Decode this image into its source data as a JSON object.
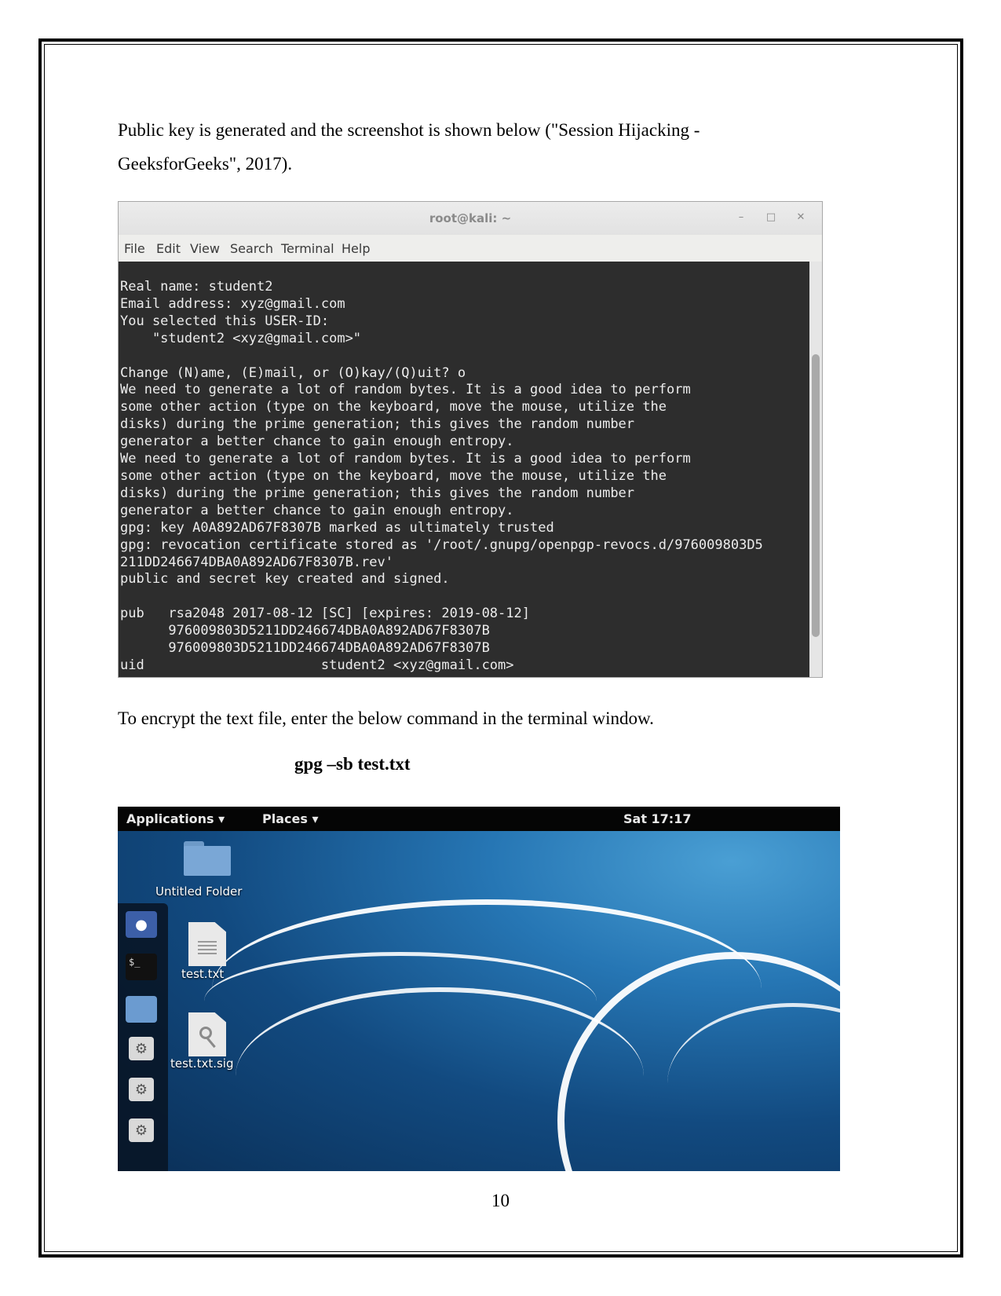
{
  "document": {
    "para1": "Public key is generated and the screenshot is shown below (\"Session Hijacking - GeeksforGeeks\", 2017).",
    "para2": "To encrypt the text file, enter the below command in the terminal window.",
    "command": "gpg –sb test.txt",
    "page_number": "10"
  },
  "terminal": {
    "title": "root@kali: ~",
    "menu": [
      "File",
      "Edit",
      "View",
      "Search",
      "Terminal",
      "Help"
    ],
    "lines": [
      "Real name: student2",
      "Email address: xyz@gmail.com",
      "You selected this USER-ID:",
      "    \"student2 <xyz@gmail.com>\"",
      "",
      "Change (N)ame, (E)mail, or (O)kay/(Q)uit? o",
      "We need to generate a lot of random bytes. It is a good idea to perform",
      "some other action (type on the keyboard, move the mouse, utilize the",
      "disks) during the prime generation; this gives the random number",
      "generator a better chance to gain enough entropy.",
      "We need to generate a lot of random bytes. It is a good idea to perform",
      "some other action (type on the keyboard, move the mouse, utilize the",
      "disks) during the prime generation; this gives the random number",
      "generator a better chance to gain enough entropy.",
      "gpg: key A0A892AD67F8307B marked as ultimately trusted",
      "gpg: revocation certificate stored as '/root/.gnupg/openpgp-revocs.d/976009803D5",
      "211DD246674DBA0A892AD67F8307B.rev'",
      "public and secret key created and signed.",
      "",
      "pub   rsa2048 2017-08-12 [SC] [expires: 2019-08-12]",
      "      976009803D5211DD246674DBA0A892AD67F8307B",
      "      976009803D5211DD246674DBA0A892AD67F8307B",
      "uid                      student2 <xyz@gmail.com>"
    ]
  },
  "desktop": {
    "applications": "Applications ▾",
    "places": "Places ▾",
    "clock": "Sat 17:17",
    "folder_label": "Untitled Folder",
    "file1_label": "test.txt",
    "file2_label": "test.txt.sig",
    "dash_icons": [
      "app-icon",
      "terminal-icon",
      "folder-icon",
      "settings-icon",
      "settings-icon",
      "settings-icon"
    ],
    "terminal_glyph": "$_"
  }
}
